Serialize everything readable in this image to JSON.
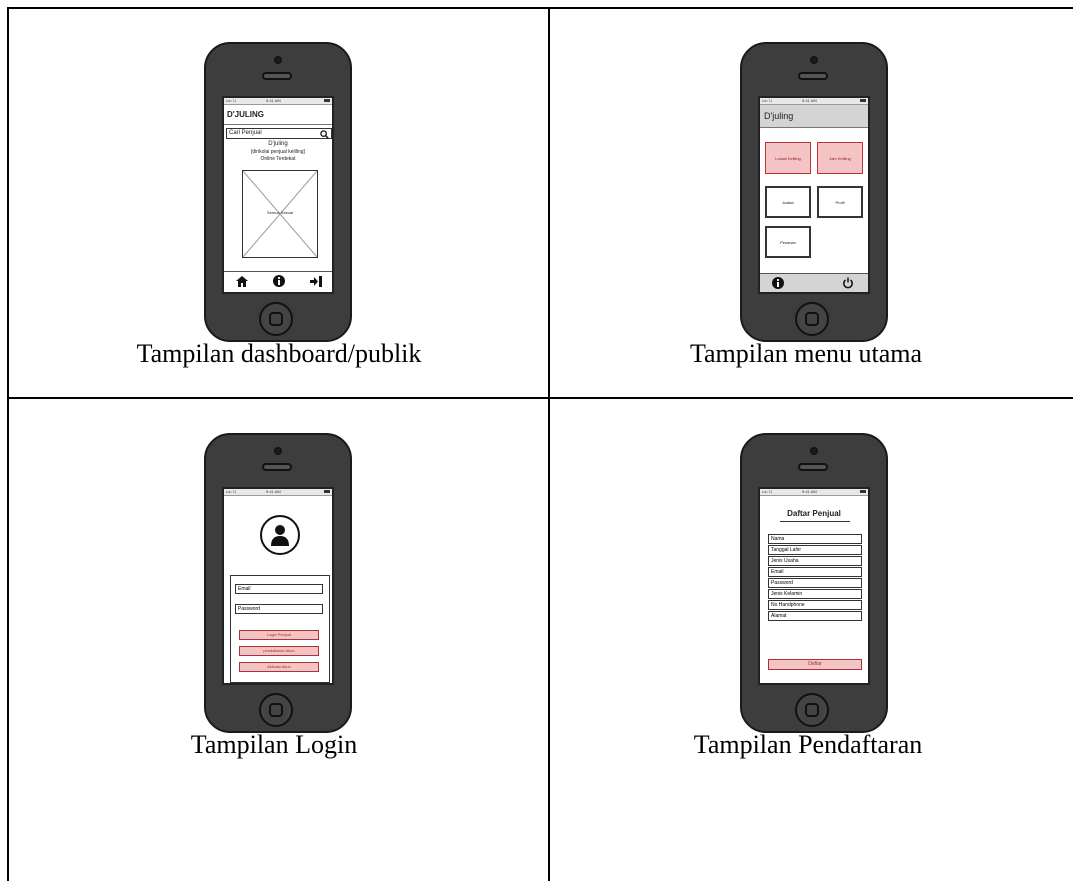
{
  "cells": [
    {
      "caption": "Tampilan dashboard/publik",
      "screen": {
        "app_title": "D'JULING",
        "search_placeholder": "Cari Penjual",
        "heading_line1": "D'juling",
        "heading_line2": "[dirikolai penjual keliling]",
        "heading_line3": "Online Terdekat",
        "image_label": "Semua Sesuai",
        "nav_icons": [
          "home-icon",
          "info-icon",
          "login-icon"
        ]
      }
    },
    {
      "caption": "Tampilan menu utama",
      "screen": {
        "app_title": "D'juling",
        "tiles": [
          "Lokasi Keliling",
          "Jam Keliling",
          "Jualan",
          "Profil",
          "Pesanan"
        ],
        "footer_icons": [
          "info-icon",
          "power-icon"
        ]
      }
    },
    {
      "caption": "Tampilan Login",
      "screen": {
        "avatar_icon": "user-icon",
        "email_placeholder": "Email",
        "password_placeholder": "Password",
        "buttons": [
          "Login Penjual",
          "pendaftaran Akun",
          "Aktivasi Akun"
        ]
      }
    },
    {
      "caption": "Tampilan Pendaftaran",
      "screen": {
        "title": "Daftar Penjual",
        "fields": [
          "Nama",
          "Tanggal Lahir",
          "Jenis Usaha",
          "Email",
          "Password",
          "Jenis Kelamin",
          "No Handphone",
          "Alamat"
        ],
        "submit": "Daftar"
      }
    }
  ],
  "colors": {
    "pink": "#f4c3c3",
    "phone_body": "#3d3d3d",
    "gray_bar": "#d4d4d4"
  }
}
